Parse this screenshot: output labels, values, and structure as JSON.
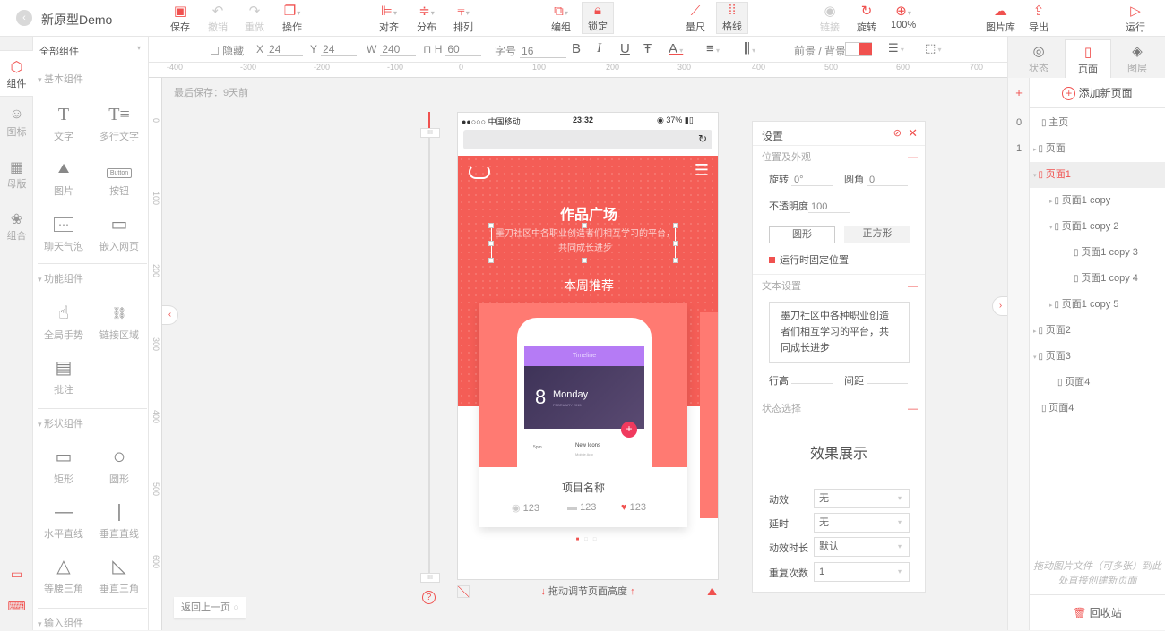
{
  "app": {
    "title": "新原型Demo",
    "back_icon": "‹"
  },
  "toolbar": {
    "save": "保存",
    "undo": "撤销",
    "redo": "重做",
    "operate": "操作",
    "align": "对齐",
    "distribute": "分布",
    "arrange": "排列",
    "group": "编组",
    "lock": "锁定",
    "ruler": "量尺",
    "grid": "格线",
    "link": "链接",
    "rotate": "旋转",
    "zoom": "100%",
    "image_lib": "图片库",
    "export": "导出",
    "run": "运行"
  },
  "props": {
    "hide_label": "隐藏",
    "x_label": "X",
    "x": "24",
    "y_label": "Y",
    "y": "24",
    "w_label": "W",
    "w": "240",
    "h_label": "H",
    "h": "60",
    "font_size_label": "字号",
    "font_size": "16",
    "fg_bg_label": "前景 / 背景",
    "bg_color": "#f0514f"
  },
  "rail": [
    {
      "label": "组件",
      "icon": "⬡"
    },
    {
      "label": "图标",
      "icon": "☺"
    },
    {
      "label": "母版",
      "icon": "▦"
    },
    {
      "label": "组合",
      "icon": "❀"
    }
  ],
  "components": {
    "filter": "全部组件",
    "sections": [
      "基本组件",
      "功能组件",
      "形状组件",
      "输入组件"
    ],
    "basic": [
      {
        "label": "文字",
        "icon": "T"
      },
      {
        "label": "多行文字",
        "icon": "T≡"
      },
      {
        "label": "图片",
        "icon": "🖼"
      },
      {
        "label": "按钮",
        "icon": "Button"
      },
      {
        "label": "聊天气泡",
        "icon": "⋯"
      },
      {
        "label": "嵌入网页",
        "icon": "▭"
      }
    ],
    "functional": [
      {
        "label": "全局手势",
        "icon": "☝"
      },
      {
        "label": "链接区域",
        "icon": "🔗"
      },
      {
        "label": "批注",
        "icon": "▤"
      }
    ],
    "shapes": [
      {
        "label": "矩形",
        "icon": "▭"
      },
      {
        "label": "圆形",
        "icon": "○"
      },
      {
        "label": "水平直线",
        "icon": "—"
      },
      {
        "label": "垂直直线",
        "icon": "|"
      },
      {
        "label": "等腰三角",
        "icon": "△"
      },
      {
        "label": "垂直三角",
        "icon": "◺"
      }
    ]
  },
  "ruler": {
    "h": [
      "-400",
      "-300",
      "-200",
      "-100",
      "0",
      "100",
      "200",
      "300",
      "400",
      "500",
      "600",
      "700"
    ],
    "v": [
      "0",
      "100",
      "200",
      "300",
      "400",
      "500",
      "600"
    ]
  },
  "canvas": {
    "last_saved": "最后保存：9天前",
    "back_page": "返回上一页",
    "drag_hint": "拖动调节页面高度"
  },
  "device": {
    "carrier": "●●○○○ 中国移动",
    "time": "23:32",
    "battery": "37%",
    "hero_title": "作品广场",
    "hero_sub": "墨刀社区中各职业创造者们相互学习的平台，共同成长进步",
    "week": "本周推荐",
    "mock": {
      "bar_title": "Timeline",
      "day": "8",
      "weekday": "Monday",
      "date": "FEBRUARY 2015",
      "time": "5pm",
      "item": "New Icons",
      "item_sub": "Mobile App"
    },
    "card_name": "项目名称",
    "views": "123",
    "comments": "123",
    "likes": "123"
  },
  "settings": {
    "title": "设置",
    "pos_section": "位置及外观",
    "rotate_label": "旋转",
    "rotate": "0°",
    "radius_label": "圆角",
    "radius": "0",
    "opacity_label": "不透明度",
    "opacity": "100",
    "circle_btn": "圆形",
    "square_btn": "正方形",
    "fixed_label": "运行时固定位置",
    "text_section": "文本设置",
    "text": "墨刀社区中各种职业创造者们相互学习的平台，共同成长进步",
    "line_height_label": "行高",
    "spacing_label": "间距",
    "state_section": "状态选择",
    "preview": "效果展示",
    "anim_label": "动效",
    "anim": "无",
    "delay_label": "延时",
    "delay": "无",
    "duration_label": "动效时长",
    "duration": "默认",
    "repeat_label": "重复次数",
    "repeat": "1"
  },
  "right": {
    "tabs": [
      {
        "label": "状态",
        "icon": "◎"
      },
      {
        "label": "页面",
        "icon": "▯"
      },
      {
        "label": "图层",
        "icon": "◈"
      }
    ],
    "nums": [
      "+",
      "0",
      "1"
    ],
    "add_page": "添加新页面",
    "pages": [
      {
        "label": "主页",
        "tri": "",
        "indent": 0
      },
      {
        "label": "页面",
        "tri": "▸",
        "indent": 0
      },
      {
        "label": "页面1",
        "tri": "▾",
        "indent": 0,
        "active": true
      },
      {
        "label": "页面1 copy",
        "tri": "▸",
        "indent": 1
      },
      {
        "label": "页面1 copy 2",
        "tri": "▾",
        "indent": 1
      },
      {
        "label": "页面1 copy 3",
        "tri": "",
        "indent": 2
      },
      {
        "label": "页面1 copy 4",
        "tri": "",
        "indent": 2
      },
      {
        "label": "页面1 copy 5",
        "tri": "▸",
        "indent": 1
      },
      {
        "label": "页面2",
        "tri": "▸",
        "indent": 0
      },
      {
        "label": "页面3",
        "tri": "▾",
        "indent": 0
      },
      {
        "label": "页面4",
        "tri": "",
        "indent": 1
      },
      {
        "label": "页面4",
        "tri": "",
        "indent": 0
      }
    ],
    "hint": "拖动图片文件（可多张）到此处直接创建新页面",
    "trash": "回收站"
  }
}
